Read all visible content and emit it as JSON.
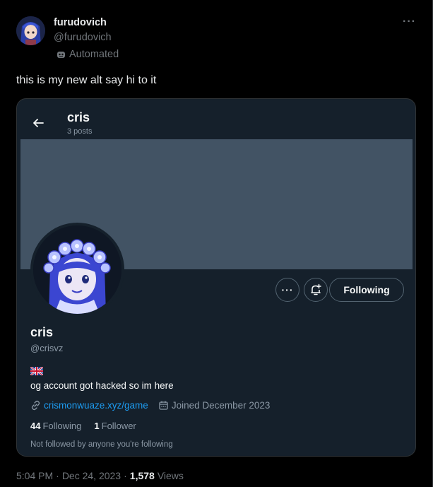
{
  "author": {
    "name": "furudovich",
    "handle": "@furudovich",
    "label": "Automated"
  },
  "tweet": {
    "text": "this is my new alt say hi to it"
  },
  "embedded": {
    "title": "cris",
    "posts": "3 posts",
    "following_button": "Following",
    "name": "cris",
    "handle": "@crisvz",
    "bio": "og account got hacked so im here",
    "link": "crismonwuaze.xyz/game",
    "joined": "Joined December 2023",
    "following_count": "44",
    "following_label": "Following",
    "follower_count": "1",
    "follower_label": "Follower",
    "not_followed": "Not followed by anyone you're following",
    "banner_color": "#425364",
    "link_color": "#1d9bf0"
  },
  "footer": {
    "time": "5:04 PM",
    "date": "Dec 24, 2023",
    "views_count": "1,578",
    "views_label": "Views"
  }
}
